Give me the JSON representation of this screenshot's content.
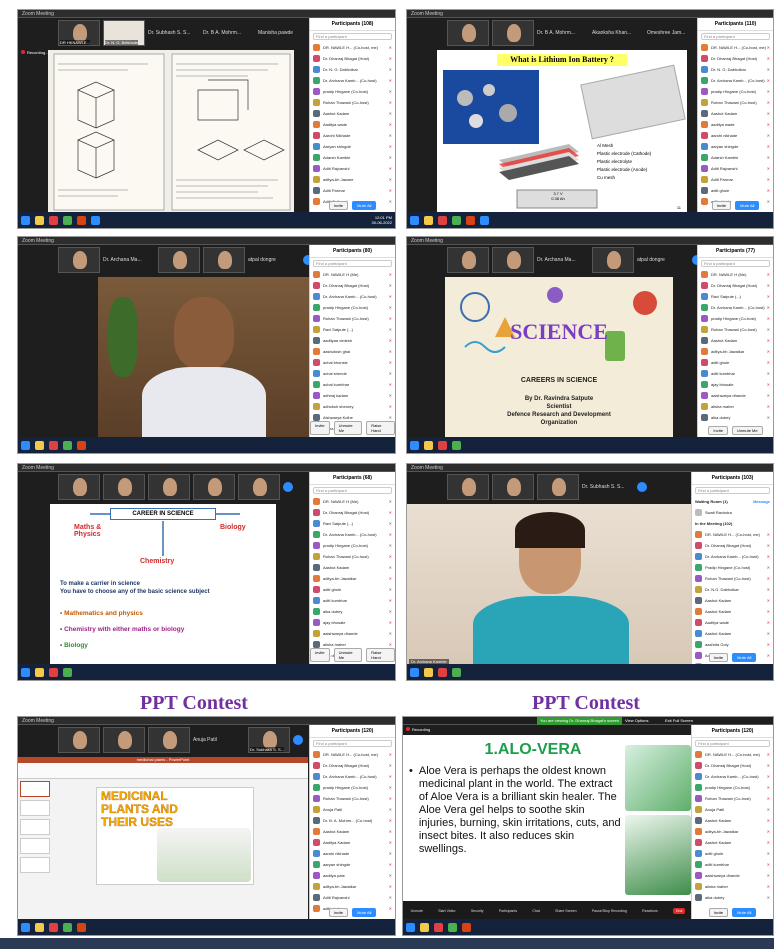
{
  "panel1": {
    "title": "Zoom Meeting",
    "strip": [
      "DR HKNAWLE...",
      "Dr. N. G. Belkhode",
      "Dr. Subhash S. S..."
    ],
    "speakers": [
      "Dr. Subhash S. S...",
      "Dr. B A. Mohrm...",
      "Manisha pawde"
    ],
    "recording": "Recording...",
    "clock": "11:27 PM",
    "participants_title": "Participants (108)",
    "search": "Find a participant",
    "people": [
      "DR. NAWLE H... (Co-host, me)",
      "Dr. Dhanraj Bhagat (Host)",
      "Dr. N. G. Dabholkar",
      "Dr. Archana Kamb... (Co-host)",
      "pradip Hingane (Co-host)",
      "Rohan Thawani (Co-host)",
      "Aashut Kadam",
      "Aaditya wade",
      "Aarohi Nikhade",
      "Aaryan shingde",
      "Adarsh Kamble",
      "Aditi Rajvanshi",
      "aditya-bh Jaware",
      "Aditi Parmar",
      "Aditi Gaikwad"
    ],
    "btns": [
      "Invite",
      "Mute All",
      "..."
    ],
    "taskclock": [
      "12:01 PM",
      "30-06-2022"
    ]
  },
  "panel2": {
    "title": "Zoom Meeting",
    "speakers": [
      "Dr. B A. Mohrm...",
      "Akanksha Khan...",
      "Omeshree Jam..."
    ],
    "slide_title": "What is Lithium Ion Battery ?",
    "labels": [
      "Al Mesh",
      "Plastic electrode (Cathode)",
      "Plastic electrolyte",
      "Plastic electrode (Anode)",
      "Cu mesh"
    ],
    "batt": [
      "3.7 V",
      "0.38 Ah"
    ],
    "page": "11",
    "participants_title": "Participants (110)",
    "search": "Find a participant",
    "people": [
      "DR. NAWLE H... (Co-host, me)",
      "Dr. Dhanraj Bhagat (Host)",
      "Dr. N. G. Dabholkar",
      "Dr. Archana Kamb... (Co-host)",
      "pradip Hingane (Co-host)",
      "Rohan Thawani (Co-host)",
      "Aashut Kadam",
      "aaditya wade",
      "aarohi nikhade",
      "aaryan shingde",
      "Adarsh Kamble",
      "Aditi Rajvanshi",
      "Aditi Parmar",
      "aditi ghule",
      "aditi shinde"
    ],
    "btns": [
      "Invite",
      "Mute All",
      "..."
    ]
  },
  "panel3": {
    "title": "Zoom Meeting",
    "speakers": [
      "Dr. Archana Ma...",
      "",
      "atpal dongre"
    ],
    "participants_title": "Participants (80)",
    "search": "Find a participant",
    "people": [
      "DR. NAWLE H (Me)",
      "Dr. Dhanraj Bhagat (Host)",
      "Dr. Archana Kamb... (Co-host)",
      "pradip Hingane (Co-host)",
      "Rohan Thawani (Co-host)",
      "Ravi Satpute (...)",
      "aadityaa vedesh",
      "aashutosh ghai",
      "achal bhonsle",
      "achal shende",
      "achal kumbhar",
      "adhiraj kadam",
      "adhoksh sheorey",
      "Aishwarya Kolhe",
      "alisha dhote"
    ],
    "btns": [
      "Invite",
      "Unmute Me",
      "Raise Hand"
    ]
  },
  "panel4": {
    "title": "Zoom Meeting",
    "speakers": [
      "Dr. Archana Ma...",
      "",
      "atpal dongre"
    ],
    "science": "SCIENCE",
    "careers": "CAREERS IN SCIENCE",
    "by": "By Dr. Ravindra Satpute",
    "role": "Scientist",
    "org1": "Defence Research and Development",
    "org2": "Organization",
    "participants_title": "Participants (77)",
    "search": "Find a participant",
    "people": [
      "DR. NAWLE H (Me)",
      "Dr. Dhanraj Bhagat (Host)",
      "Ravi Satpute (...)",
      "Dr. Archana Kamb... (Co-host)",
      "pradip Hingane (Co-host)",
      "Rohan Thawani (Co-host)",
      "Aashut Kadam",
      "aditya-bh Jawalkar",
      "aditi ghule",
      "aditi kumbhar",
      "ajay bhosale",
      "aaishwarya dhande",
      "alisha maher",
      "alka dubey"
    ],
    "btns": [
      "Invite",
      "Unmute Me",
      "Raise Hand"
    ]
  },
  "panel5": {
    "title": "Zoom Meeting",
    "slide_head": "CAREER IN SCIENCE",
    "left": "Maths & Physics",
    "right": "Biology",
    "mid": "Chemistry",
    "intro1": "To make a carrier in science",
    "intro2": "You have to choose any of the basic science subject",
    "bullets": [
      "Mathematics and physics",
      "Chemistry with either maths or biology",
      "Biology"
    ],
    "participants_title": "Participants (68)",
    "search": "Find a participant",
    "people": [
      "DR. NAWLE H (Me)",
      "Dr. Dhanraj Bhagat (Host)",
      "Ravi Satpute (...)",
      "Dr. Archana Kamb... (Co-host)",
      "pradip Hingane (Co-host)",
      "Rohan Thawani (Co-host)",
      "Aashut Kadam",
      "aditya-bh Jawalkar",
      "aditi ghule",
      "aditi kumbhar",
      "alka dubey",
      "ajay bhosale",
      "aaishwarya dhande",
      "alisha maher",
      "alka dubey"
    ],
    "btns": [
      "Invite",
      "Unmute Me",
      "Raise Hand"
    ]
  },
  "panel6": {
    "title": "Zoom Meeting",
    "speakers": [
      "Dr. Subhash S. S..."
    ],
    "name_tag": "Dr. Archana Kamble",
    "participants_title": "Participants (103)",
    "search": "Find a participant",
    "waiting": "Waiting Room (1)",
    "message": "Message",
    "waiting_person": "Swati Ravindra",
    "in_meeting": "In the Meeting (102)",
    "people": [
      "DR. NAWLE H... (Co-host, me)",
      "Dr. Dhanraj Bhagat (Host)",
      "Dr. Archana Kamb... (Co-host)",
      "Pradip Hingane (Co-host)",
      "Rohan Thawani (Co-host)",
      "Dr. N.G. Dabholkar",
      "Aashut Kadam",
      "Aashut Kadam",
      "Aaditya wade",
      "Aashut Kadam",
      "aashrita Goly",
      "Aditi Parmar",
      "Adarsh Kamble"
    ],
    "btns": [
      "Invite",
      "Mute All",
      "..."
    ]
  },
  "contest_left": "PPT Contest",
  "contest_right": "PPT Contest",
  "panel7": {
    "title": "Zoom Meeting",
    "speakers": [
      "",
      "",
      "Anuja Patil",
      "Dr. Subhash S. S..."
    ],
    "doc_title": "medicinal plants - PowerPoint",
    "slide_lines": [
      "MEDICINAL",
      "PLANTS AND",
      "THEIR USES"
    ],
    "participants_title": "Participants (120)",
    "search": "Find a participant",
    "people": [
      "DR. NAWLE H... (Co-host, me)",
      "Dr. Dhanraj Bhagat (Host)",
      "Dr. Archana Kamb... (Co-host)",
      "pradip Hingane (Co-host)",
      "Rohan Thawani (Co-host)",
      "Anuja Patil",
      "Dr. B. A. Mohrm... (Co-host)",
      "Aashut Kadam",
      "Aaditya Kadam",
      "aarohi nikhade",
      "aaryan shingde",
      "aaditya pate",
      "aditya-bh Jawalkar",
      "Aditi Rajvanshi",
      "aditi ghule"
    ],
    "btns": [
      "Invite",
      "Mute All",
      "..."
    ]
  },
  "panel8": {
    "banner": "You are viewing Dr. Dhanraj Bhagat's screen",
    "view_options": "View Options",
    "exit_full": "Exit Full Screen",
    "recording": "Recording",
    "slide_title": "1.ALO-VERA",
    "text": "Aloe Vera is perhaps the oldest known medicinal plant in the world. The extract of Aloe Vera is a brilliant skin healer. The Aloe Vera gel helps to soothe skin injuries, burning, skin irritations, cuts, and insect bites. It also reduces skin swellings.",
    "toolbar": [
      "Unmute",
      "Start Video",
      "Security",
      "Participants",
      "Chat",
      "Share Screen",
      "Pause/Stop Recording",
      "Reactions",
      "End"
    ],
    "participants_title": "Participants (120)",
    "search": "Find a participant",
    "people": [
      "DR. NAWLE H... (Co-host, me)",
      "Dr. Dhanraj Bhagat (Host)",
      "Dr. Archana Kamb... (Co-host)",
      "pradip Hingane (Co-host)",
      "Rohan Thawani (Co-host)",
      "Anuja Patil",
      "Aashut Kadam",
      "aditya-bh Jawalkar",
      "Aashut Kadam",
      "aditi ghule",
      "aditi kumbhar",
      "aaishwarya dhande",
      "alisha maher",
      "alka dubey"
    ],
    "btns": [
      "Invite",
      "Mute All",
      "..."
    ]
  }
}
